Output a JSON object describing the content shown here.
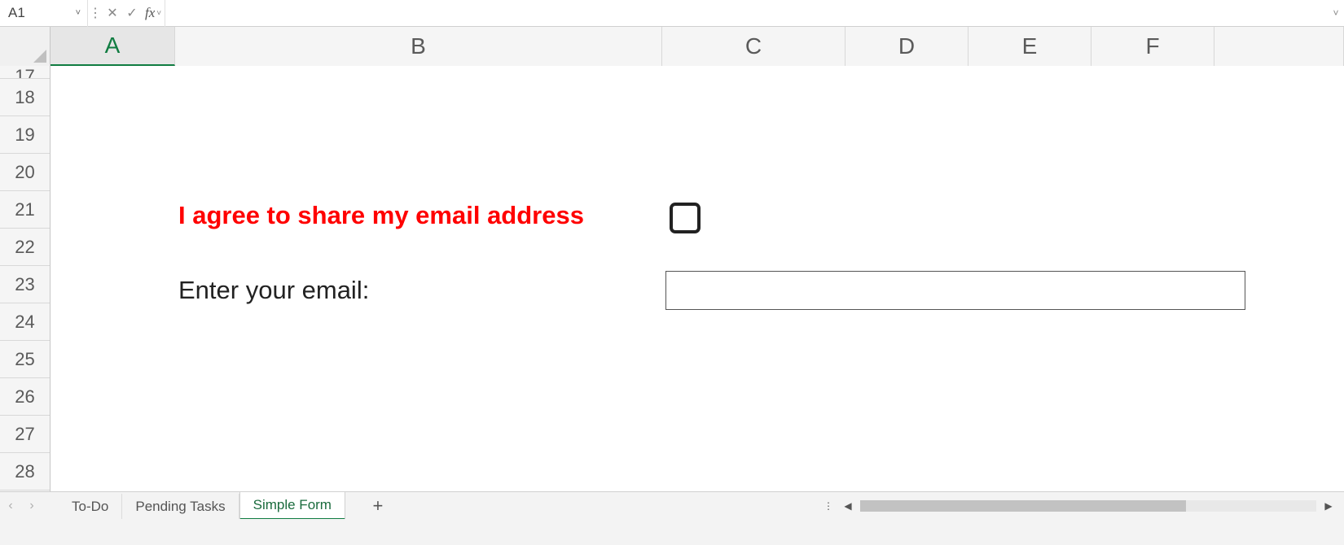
{
  "formula_bar": {
    "name_box": "A1",
    "fx_label": "fx",
    "formula_value": ""
  },
  "columns": [
    "A",
    "B",
    "C",
    "D",
    "E",
    "F"
  ],
  "active_column": "A",
  "visible_rows": [
    "17",
    "18",
    "19",
    "20",
    "21",
    "22",
    "23",
    "24",
    "25",
    "26",
    "27",
    "28"
  ],
  "form": {
    "agree_label": "I agree to share my email address",
    "agree_checked": false,
    "email_label": "Enter your email:",
    "email_value": ""
  },
  "sheet_tabs": {
    "tabs": [
      "To-Do",
      "Pending Tasks",
      "Simple Form"
    ],
    "active": "Simple Form"
  },
  "icons": {
    "cancel": "✕",
    "accept": "✓",
    "dots": "⋮",
    "chev_down": "˅",
    "tri_left": "◀",
    "tri_right": "▶",
    "plus": "+",
    "chev_left": "‹",
    "chev_right": "›"
  }
}
